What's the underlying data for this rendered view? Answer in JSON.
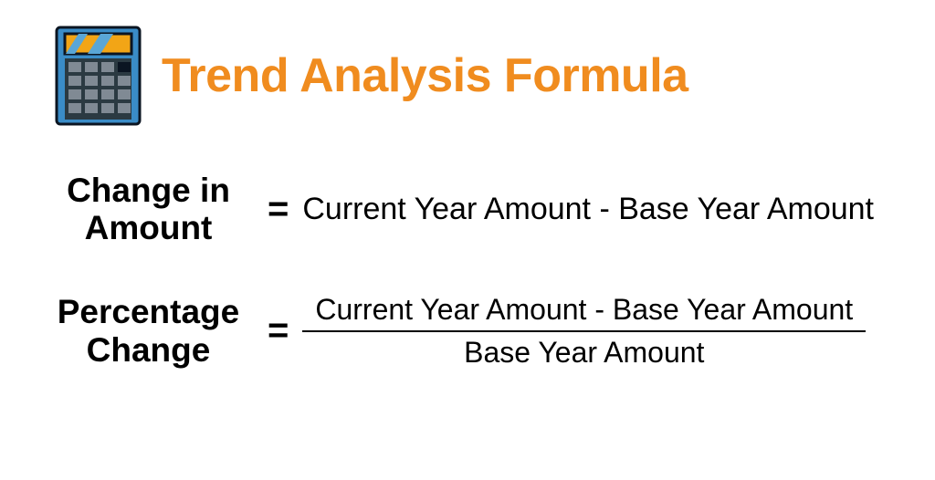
{
  "title": "Trend Analysis Formula",
  "formula1": {
    "label_line1": "Change in",
    "label_line2": "Amount",
    "right": "Current Year Amount - Base Year Amount"
  },
  "formula2": {
    "label_line1": "Percentage",
    "label_line2": "Change",
    "numerator": "Current Year Amount - Base Year Amount",
    "denominator": "Base Year Amount"
  }
}
